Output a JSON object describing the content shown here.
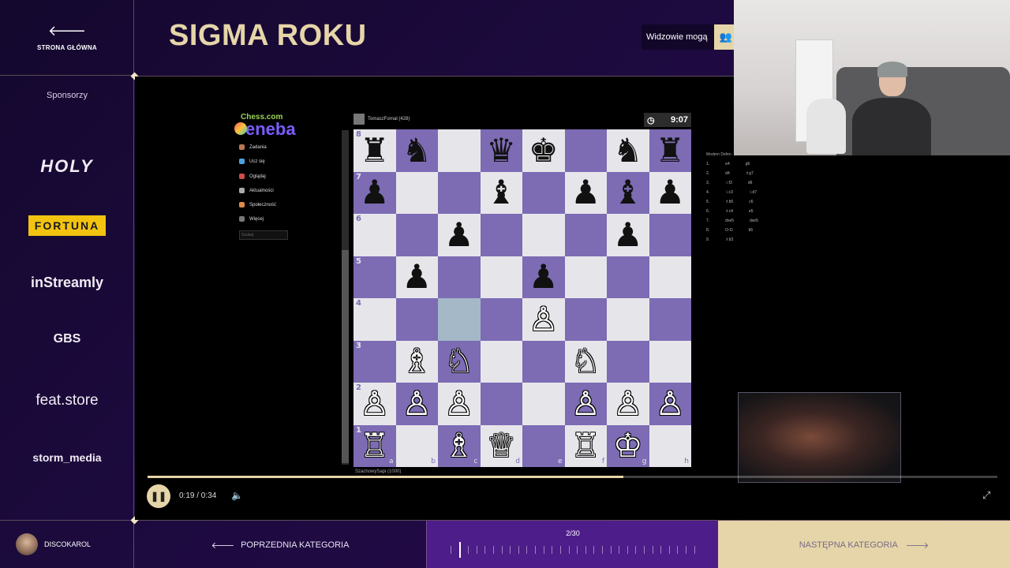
{
  "sidebar": {
    "home_label": "STRONA GŁÓWNA",
    "sponsors_title": "Sponsorzy",
    "sponsors": [
      "HOLY",
      "FORTUNA",
      "inStreamly",
      "GBS",
      "feat.store",
      "storm_media"
    ]
  },
  "header": {
    "title": "SIGMA ROKU",
    "viewers_label": "Widzowie mogą"
  },
  "user": {
    "name": "DISCOKAROL"
  },
  "video": {
    "time_current": "0:19",
    "time_total": "0:34",
    "time_display": "0:19 / 0:34",
    "progress": 0.56,
    "chess": {
      "site": "Chess.com",
      "sponsor_logo": "eneba",
      "nav": [
        "Zadania",
        "Ucz się",
        "Oglądaj",
        "Aktualności",
        "Społeczność",
        "Więcej"
      ],
      "search_placeholder": "Szukaj",
      "top_player": "TomaszFornal (428)",
      "clock": "9:07",
      "bottom_player": "SzachowySapi (1000)",
      "opening": "Modern Defen",
      "moves": [
        [
          "1.",
          "e4",
          "g6"
        ],
        [
          "2.",
          "d4",
          "♗g7"
        ],
        [
          "3.",
          "♘f3",
          "d6"
        ],
        [
          "4.",
          "♘c3",
          "♘d7"
        ],
        [
          "5.",
          "♗b5",
          "c6"
        ],
        [
          "6.",
          "♗c4",
          "e5"
        ],
        [
          "7.",
          "dxe5",
          "dxe5"
        ],
        [
          "8.",
          "O-O",
          "b5"
        ],
        [
          "9.",
          "♗b3",
          ""
        ]
      ]
    }
  },
  "bottom": {
    "prev_label": "POPRZEDNIA KATEGORIA",
    "next_label": "NASTĘPNA KATEGORIA",
    "counter": "2/30",
    "current": 2,
    "total": 30
  }
}
